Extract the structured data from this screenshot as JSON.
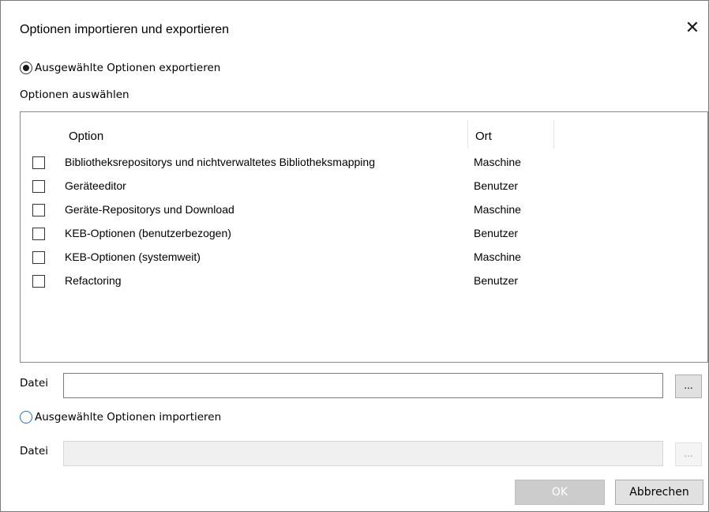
{
  "window": {
    "title": "Optionen importieren und exportieren",
    "close_glyph": "✕"
  },
  "export": {
    "radio_label": "Ausgewählte Optionen exportieren",
    "selected": true,
    "section_label": "Optionen auswählen",
    "columns": [
      "Option",
      "Ort"
    ],
    "rows": [
      {
        "option": "Bibliotheksrepositorys und nichtverwaltetes Bibliotheksmapping",
        "ort": "Maschine",
        "checked": false
      },
      {
        "option": "Geräteeditor",
        "ort": "Benutzer",
        "checked": false
      },
      {
        "option": "Geräte-Repositorys und Download",
        "ort": "Maschine",
        "checked": false
      },
      {
        "option": "KEB-Optionen (benutzerbezogen)",
        "ort": "Benutzer",
        "checked": false
      },
      {
        "option": "KEB-Optionen (systemweit)",
        "ort": "Maschine",
        "checked": false
      },
      {
        "option": "Refactoring",
        "ort": "Benutzer",
        "checked": false
      }
    ],
    "file_label": "Datei",
    "file_value": "",
    "browse_label": "..."
  },
  "import": {
    "radio_label": "Ausgewählte Optionen importieren",
    "selected": false,
    "file_label": "Datei",
    "file_value": "",
    "browse_label": "..."
  },
  "footer": {
    "ok_label": "OK",
    "cancel_label": "Abbrechen"
  },
  "colors": {
    "radio_unselected_accent": "#1e73d8",
    "disabled_button_bg": "#cccccc"
  }
}
